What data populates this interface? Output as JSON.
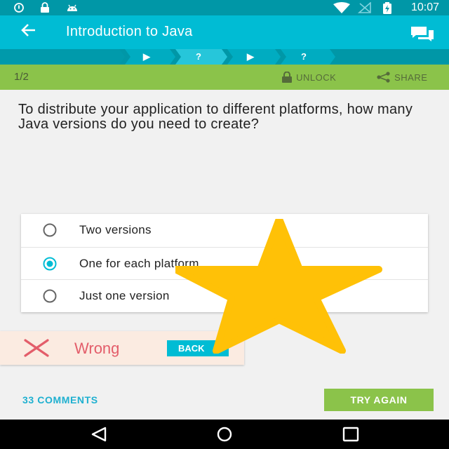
{
  "status_bar": {
    "time": "10:07",
    "left_icons": [
      "alert-icon",
      "lock-icon",
      "android-icon"
    ],
    "right_icons": [
      "wifi-icon",
      "no-sim-icon",
      "battery-charging-icon"
    ]
  },
  "app_bar": {
    "title": "Introduction to Java",
    "back_icon": "arrow-back-icon",
    "action_icon": "chat-icon"
  },
  "progress": {
    "steps": [
      "▶",
      "?",
      "▶",
      "?"
    ]
  },
  "quiz_header": {
    "counter": "1/2",
    "unlock_label": "UNLOCK",
    "share_label": "SHARE"
  },
  "question": {
    "text": "To distribute your application to different platforms, how many Java versions do you need to create?"
  },
  "options": [
    {
      "label": "Two versions",
      "selected": false
    },
    {
      "label": "One for each platform",
      "selected": true
    },
    {
      "label": "Just one version",
      "selected": false
    }
  ],
  "result": {
    "text": "Wrong",
    "back_label": "BACK"
  },
  "footer": {
    "comments_label": "33 COMMENTS",
    "try_again_label": "TRY AGAIN"
  },
  "colors": {
    "primary": "#00bcd4",
    "primary_dark": "#0097a7",
    "green": "#8bc34a",
    "wrong": "#e35d6a",
    "star": "#ffc107"
  }
}
